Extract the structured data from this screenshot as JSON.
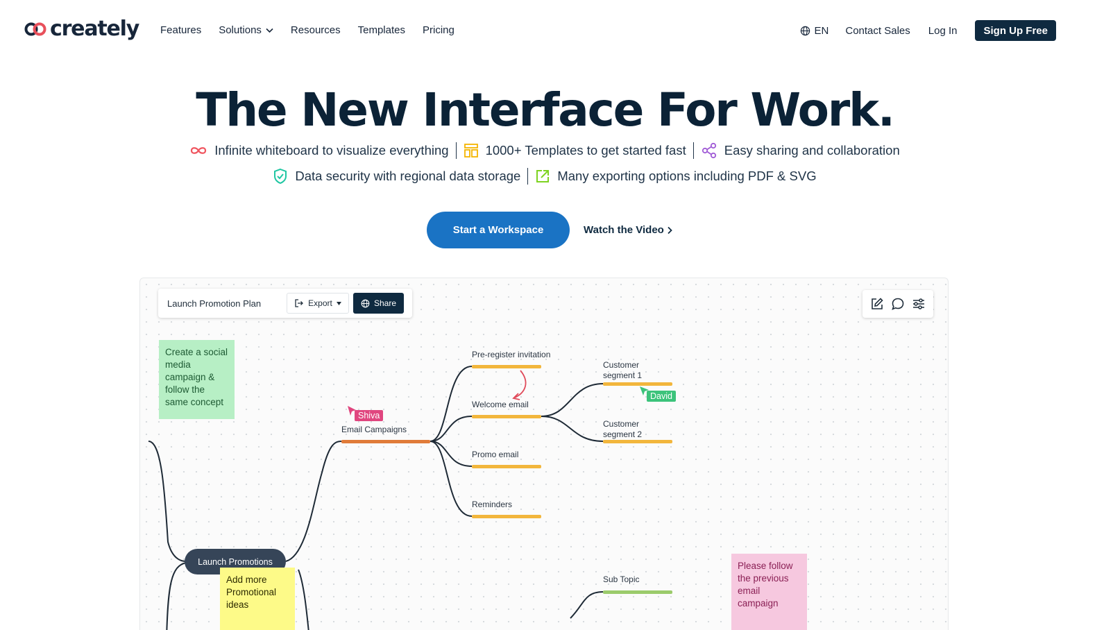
{
  "nav": {
    "logo_text": "creately",
    "links": [
      "Features",
      "Solutions",
      "Resources",
      "Templates",
      "Pricing"
    ],
    "lang": "EN",
    "contact_sales": "Contact Sales",
    "login": "Log In",
    "signup": "Sign Up Free"
  },
  "hero": {
    "title": "The New Interface For Work.",
    "features_row1": [
      {
        "text": "Infinite whiteboard to visualize everything",
        "icon": "infinity-icon",
        "color": "#f0555f"
      },
      {
        "text": "1000+ Templates to get started fast",
        "icon": "templates-icon",
        "color": "#f4b400"
      },
      {
        "text": "Easy sharing and collaboration",
        "icon": "share-icon",
        "color": "#a05bd6"
      }
    ],
    "features_row2": [
      {
        "text": "Data security with regional data storage",
        "icon": "shield-icon",
        "color": "#1fc6a2"
      },
      {
        "text": "Many exporting options including PDF & SVG",
        "icon": "export-icon",
        "color": "#7ed321"
      }
    ],
    "cta_primary": "Start a Workspace",
    "cta_secondary": "Watch the Video"
  },
  "demo": {
    "doc_title": "Launch Promotion Plan",
    "export_label": "Export",
    "share_label": "Share",
    "central_node": "Launch Promotions",
    "email_campaigns": "Email Campaigns",
    "pre_register": "Pre-register invitation",
    "welcome_email": "Welcome email",
    "promo_email": "Promo email",
    "reminders": "Reminders",
    "segment1_line1": "Customer",
    "segment1_line2": "segment 1",
    "segment2_line1": "Customer",
    "segment2_line2": "segment 2",
    "sub_topic": "Sub Topic",
    "sticky_green": "Create a social media campaign & follow the same concept",
    "sticky_yellow": "Add more Promotional ideas",
    "sticky_pink": "Please follow the previous email campaign",
    "cursor_shiva": "Shiva",
    "cursor_david": "David"
  }
}
